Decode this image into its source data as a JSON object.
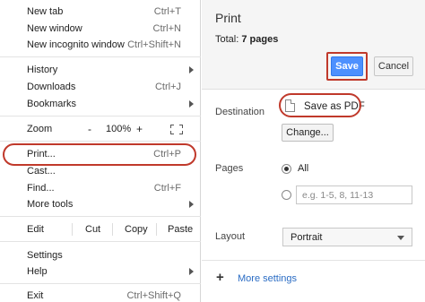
{
  "menu": {
    "new_tab": {
      "label": "New tab",
      "shortcut": "Ctrl+T"
    },
    "new_window": {
      "label": "New window",
      "shortcut": "Ctrl+N"
    },
    "new_incognito": {
      "label": "New incognito window",
      "shortcut": "Ctrl+Shift+N"
    },
    "history": {
      "label": "History"
    },
    "downloads": {
      "label": "Downloads",
      "shortcut": "Ctrl+J"
    },
    "bookmarks": {
      "label": "Bookmarks"
    },
    "zoom": {
      "label": "Zoom",
      "minus": "-",
      "value": "100%",
      "plus": "+"
    },
    "print": {
      "label": "Print...",
      "shortcut": "Ctrl+P"
    },
    "cast": {
      "label": "Cast..."
    },
    "find": {
      "label": "Find...",
      "shortcut": "Ctrl+F"
    },
    "more_tools": {
      "label": "More tools"
    },
    "edit": {
      "label": "Edit",
      "cut": "Cut",
      "copy": "Copy",
      "paste": "Paste"
    },
    "settings": {
      "label": "Settings"
    },
    "help": {
      "label": "Help"
    },
    "exit": {
      "label": "Exit",
      "shortcut": "Ctrl+Shift+Q"
    }
  },
  "print_panel": {
    "title": "Print",
    "total_label": "Total:",
    "total_value": "7 pages",
    "save_label": "Save",
    "cancel_label": "Cancel",
    "destination_label": "Destination",
    "destination_value": "Save as PDF",
    "change_label": "Change...",
    "pages_label": "Pages",
    "pages_all": "All",
    "pages_placeholder": "e.g. 1-5, 8, 11-13",
    "layout_label": "Layout",
    "layout_value": "Portrait",
    "more_settings": "More settings"
  },
  "colors": {
    "accent": "#4d90fe",
    "highlight": "#c0392b",
    "link": "#2a6cc4"
  },
  "icons": [
    "submenu-arrow-icon",
    "fullscreen-icon",
    "document-icon",
    "plus-icon",
    "dropdown-caret-icon"
  ]
}
